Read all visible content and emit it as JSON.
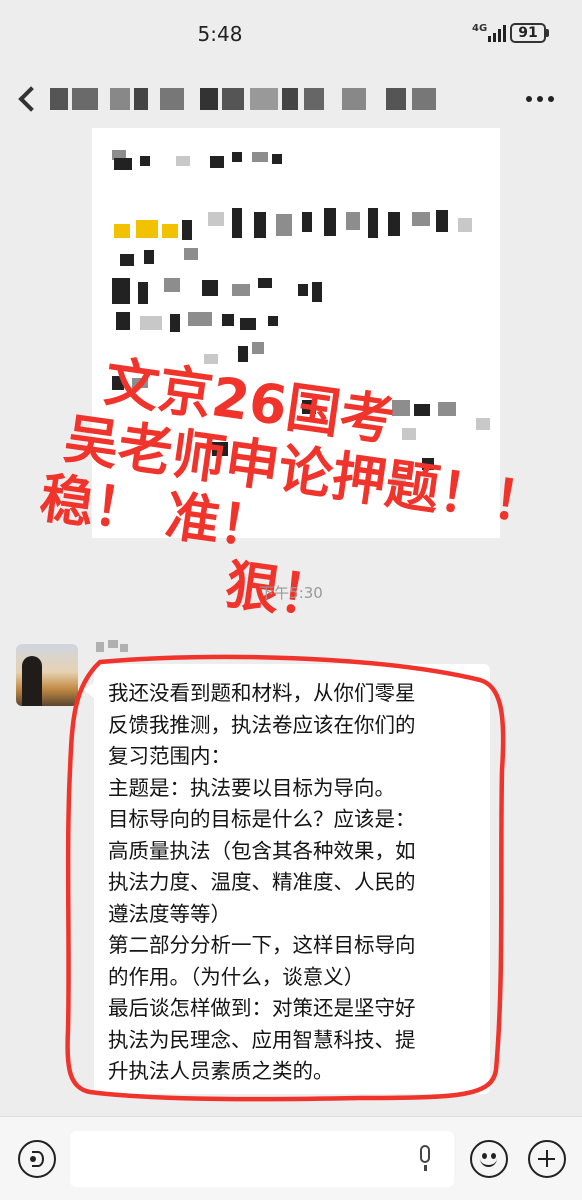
{
  "status_bar": {
    "time": "5:48",
    "network": "4G",
    "battery": "91"
  },
  "image_message": {
    "watermark_lines": [
      "文京26国考",
      "吴老师申论押题！！",
      "稳！ 准！",
      "狠！"
    ]
  },
  "timestamp": "下午5:30",
  "message": {
    "lines": [
      "我还没看到题和材料，从你们零星",
      "反馈我推测，执法卷应该在你们的",
      "复习范围内：",
      "主题是：执法要以目标为导向。",
      "目标导向的目标是什么？应该是：",
      "高质量执法（包含其各种效果，如",
      "执法力度、温度、精准度、人民的",
      "遵法度等等）",
      "第二部分分析一下，这样目标导向",
      "的作用。（为什么，谈意义）",
      "最后谈怎样做到：对策还是坚守好",
      "执法为民理念、应用智慧科技、提",
      "升执法人员素质之类的。"
    ]
  },
  "colors": {
    "background": "#ededed",
    "annotation_red": "#f0342c",
    "bubble": "#ffffff"
  },
  "icons": [
    "back-icon",
    "more-icon",
    "voice-icon",
    "mic-icon",
    "emoji-icon",
    "plus-icon"
  ]
}
